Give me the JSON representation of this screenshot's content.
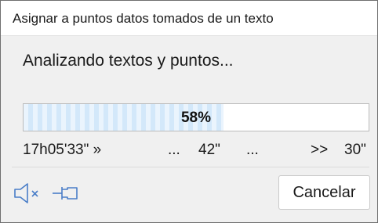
{
  "window": {
    "title": "Asignar a puntos datos tomados de un texto"
  },
  "status": {
    "message": "Analizando textos y puntos..."
  },
  "progress": {
    "percent": 58,
    "label": "58%"
  },
  "times": {
    "start": "17h05'33\" »",
    "dots_1": "...",
    "middle": "42\"",
    "dots_2": "...",
    "arrows": ">>",
    "end": "30\""
  },
  "footer": {
    "sound_icon": "speaker-muted-icon",
    "pin_icon": "pin-icon",
    "cancel_label": "Cancelar"
  },
  "colors": {
    "progress_fill": "#d3e8fa",
    "accent": "#4a7ec8",
    "background": "#f0f0f0"
  }
}
